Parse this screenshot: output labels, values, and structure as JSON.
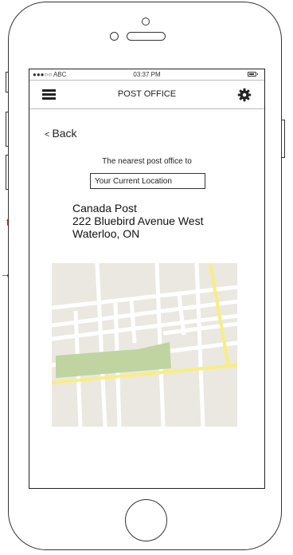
{
  "status_bar": {
    "carrier": "●●●○○ ABC",
    "time": "03:37 PM",
    "battery_icon": "battery-icon"
  },
  "nav_bar": {
    "menu_icon": "hamburger-menu-icon",
    "title": "POST OFFICE",
    "settings_icon": "gear-icon"
  },
  "back": {
    "chevron": "<",
    "label": "Back"
  },
  "search": {
    "prompt": "The nearest post office to",
    "location_value": "Your Current Location"
  },
  "result": {
    "name": "Canada Post",
    "street": "222 Bluebird Avenue West",
    "city": "Waterloo, ON"
  },
  "annotations": {
    "label_fragment": "t",
    "arrow": "→"
  },
  "colors": {
    "map_background": "#ebe8e1",
    "map_road": "#ffffff",
    "map_highway": "#f8ee82",
    "map_park": "#bfd4a1",
    "annotation_red": "#d22020"
  }
}
